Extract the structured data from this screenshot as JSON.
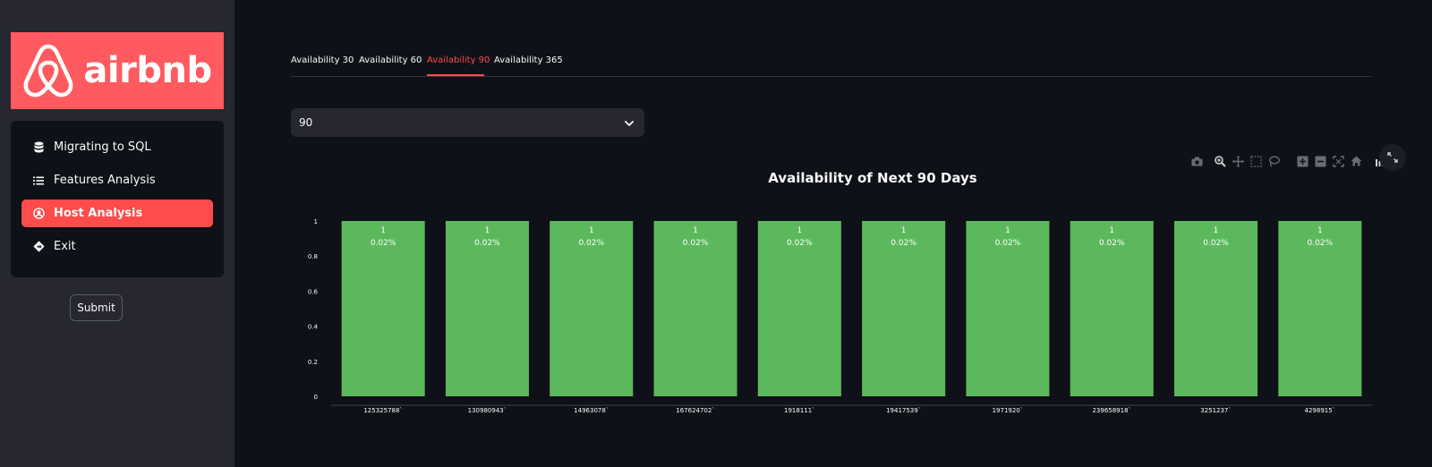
{
  "sidebar": {
    "logo_text": "airbnb",
    "items": [
      {
        "label": "Migrating to SQL",
        "icon": "database-icon",
        "active": false
      },
      {
        "label": "Features Analysis",
        "icon": "list-icon",
        "active": false
      },
      {
        "label": "Host Analysis",
        "icon": "user-circle-icon",
        "active": true
      },
      {
        "label": "Exit",
        "icon": "diamond-arrow-icon",
        "active": false
      }
    ],
    "submit_label": "Submit"
  },
  "tabs": [
    {
      "label": "Availability 30",
      "active": false
    },
    {
      "label": "Availability 60",
      "active": false
    },
    {
      "label": "Availability 90",
      "active": true
    },
    {
      "label": "Availability 365",
      "active": false
    }
  ],
  "select": {
    "value": "90",
    "icon": "chevron-down-icon"
  },
  "colors": {
    "brand": "#ff5a5f",
    "accent": "#ff4b4b",
    "bar": "#5cb85c"
  },
  "chart_data": {
    "type": "bar",
    "title": "Availability of Next 90 Days",
    "categories": [
      "125325788`",
      "130980943`",
      "14963078`",
      "167624702`",
      "1918111`",
      "19417539`",
      "1971920`",
      "239658918`",
      "3251237`",
      "4298915`"
    ],
    "values": [
      1,
      1,
      1,
      1,
      1,
      1,
      1,
      1,
      1,
      1
    ],
    "labels": [
      "0.02%",
      "0.02%",
      "0.02%",
      "0.02%",
      "0.02%",
      "0.02%",
      "0.02%",
      "0.02%",
      "0.02%",
      "0.02%"
    ],
    "yticks": [
      "0",
      "0.2",
      "0.4",
      "0.6",
      "0.8",
      "1"
    ],
    "ylim": [
      0,
      1
    ],
    "grid": false,
    "legend": false
  }
}
